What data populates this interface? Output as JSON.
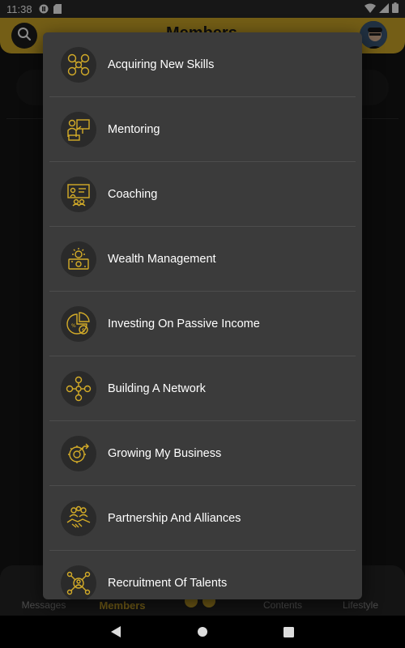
{
  "status_bar": {
    "time": "11:38"
  },
  "header": {
    "title": "Members"
  },
  "bottom_nav": {
    "items": [
      {
        "label": "Messages"
      },
      {
        "label": "Members"
      },
      {
        "label": "Contents"
      },
      {
        "label": "Lifestyle"
      }
    ]
  },
  "colors": {
    "accent": "#d4ac28",
    "modal_bg": "#3b3b3b",
    "divider": "#4d4d4d"
  },
  "menu": {
    "items": [
      {
        "label": "Acquiring New Skills",
        "icon": "skills-icon"
      },
      {
        "label": "Mentoring",
        "icon": "mentoring-icon"
      },
      {
        "label": "Coaching",
        "icon": "coaching-icon"
      },
      {
        "label": "Wealth Management",
        "icon": "wealth-icon"
      },
      {
        "label": "Investing On Passive Income",
        "icon": "investing-icon"
      },
      {
        "label": "Building A Network",
        "icon": "network-icon"
      },
      {
        "label": "Growing My Business",
        "icon": "business-growth-icon"
      },
      {
        "label": "Partnership And Alliances",
        "icon": "handshake-icon"
      },
      {
        "label": "Recruitment Of Talents",
        "icon": "recruitment-icon"
      }
    ]
  }
}
